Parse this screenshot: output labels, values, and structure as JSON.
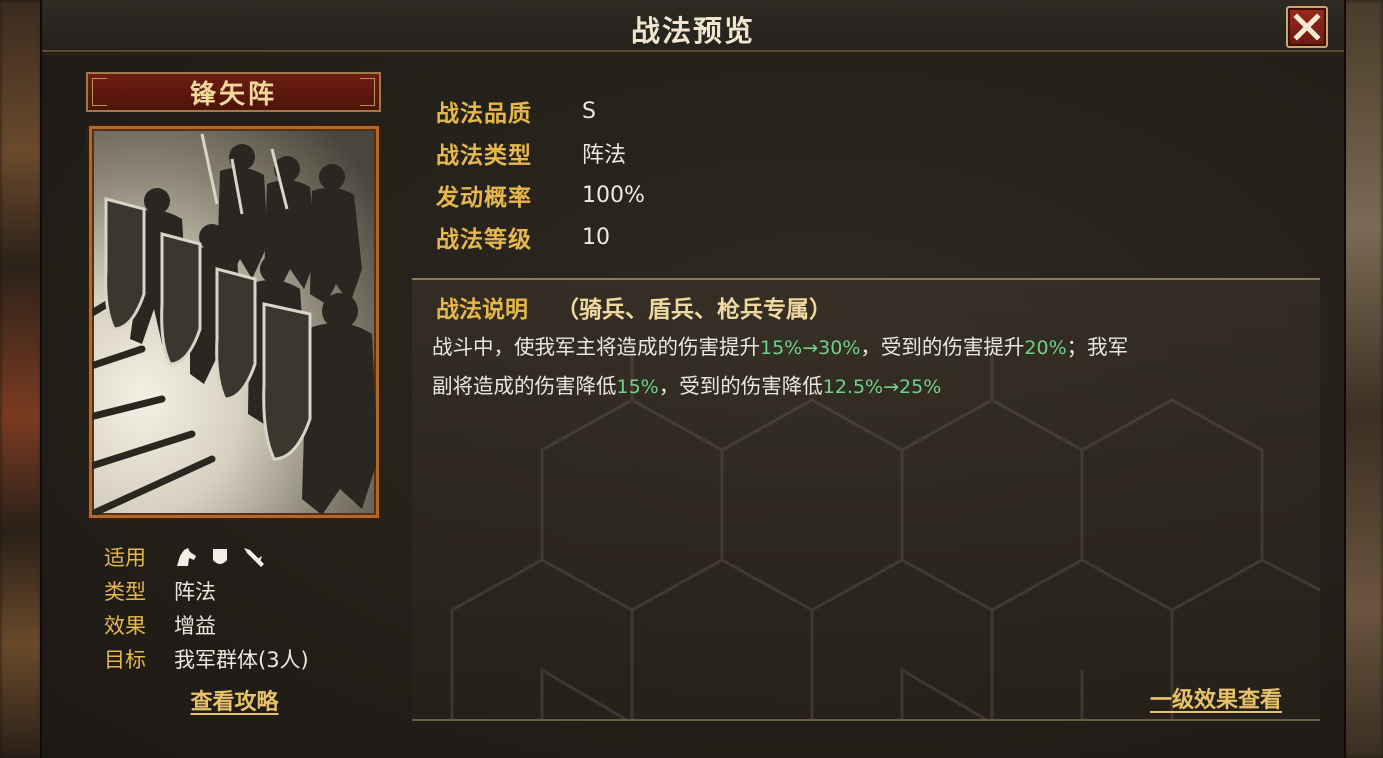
{
  "window": {
    "title": "战法预览",
    "close_icon": "close-x-icon"
  },
  "skill": {
    "name": "锋矢阵",
    "image": "troops-formation-silhouette"
  },
  "info": {
    "applicable_label": "适用",
    "applicable_units": [
      "cavalry-icon",
      "shield-infantry-icon",
      "spear-infantry-icon"
    ],
    "type_label": "类型",
    "type_value": "阵法",
    "effect_label": "效果",
    "effect_value": "增益",
    "target_label": "目标",
    "target_value": "我军群体(3人)"
  },
  "guide_link": "查看攻略",
  "stats": [
    {
      "label": "战法品质",
      "value": "S"
    },
    {
      "label": "战法类型",
      "value": "阵法"
    },
    {
      "label": "发动概率",
      "value": "100%"
    },
    {
      "label": "战法等级",
      "value": "10"
    }
  ],
  "description": {
    "title": "战法说明",
    "exclusive": "（骑兵、盾兵、枪兵专属）",
    "line1_a": "战斗中，使我军主将造成的伤害提升",
    "line1_hl1": "15%→30%",
    "line1_b": "，受到的伤害提升",
    "line1_hl2": "20%",
    "line1_c": "；我军",
    "line2_a": "副将造成的伤害降低",
    "line2_hl1": "15%",
    "line2_b": "，受到的伤害降低",
    "line2_hl2": "12.5%→25%"
  },
  "level_link": "一级效果查看",
  "colors": {
    "gold_label": "#e6b84c",
    "highlight_green": "#6fd18a",
    "link_gold": "#e7c268",
    "name_banner_red": "#6e1d12"
  }
}
